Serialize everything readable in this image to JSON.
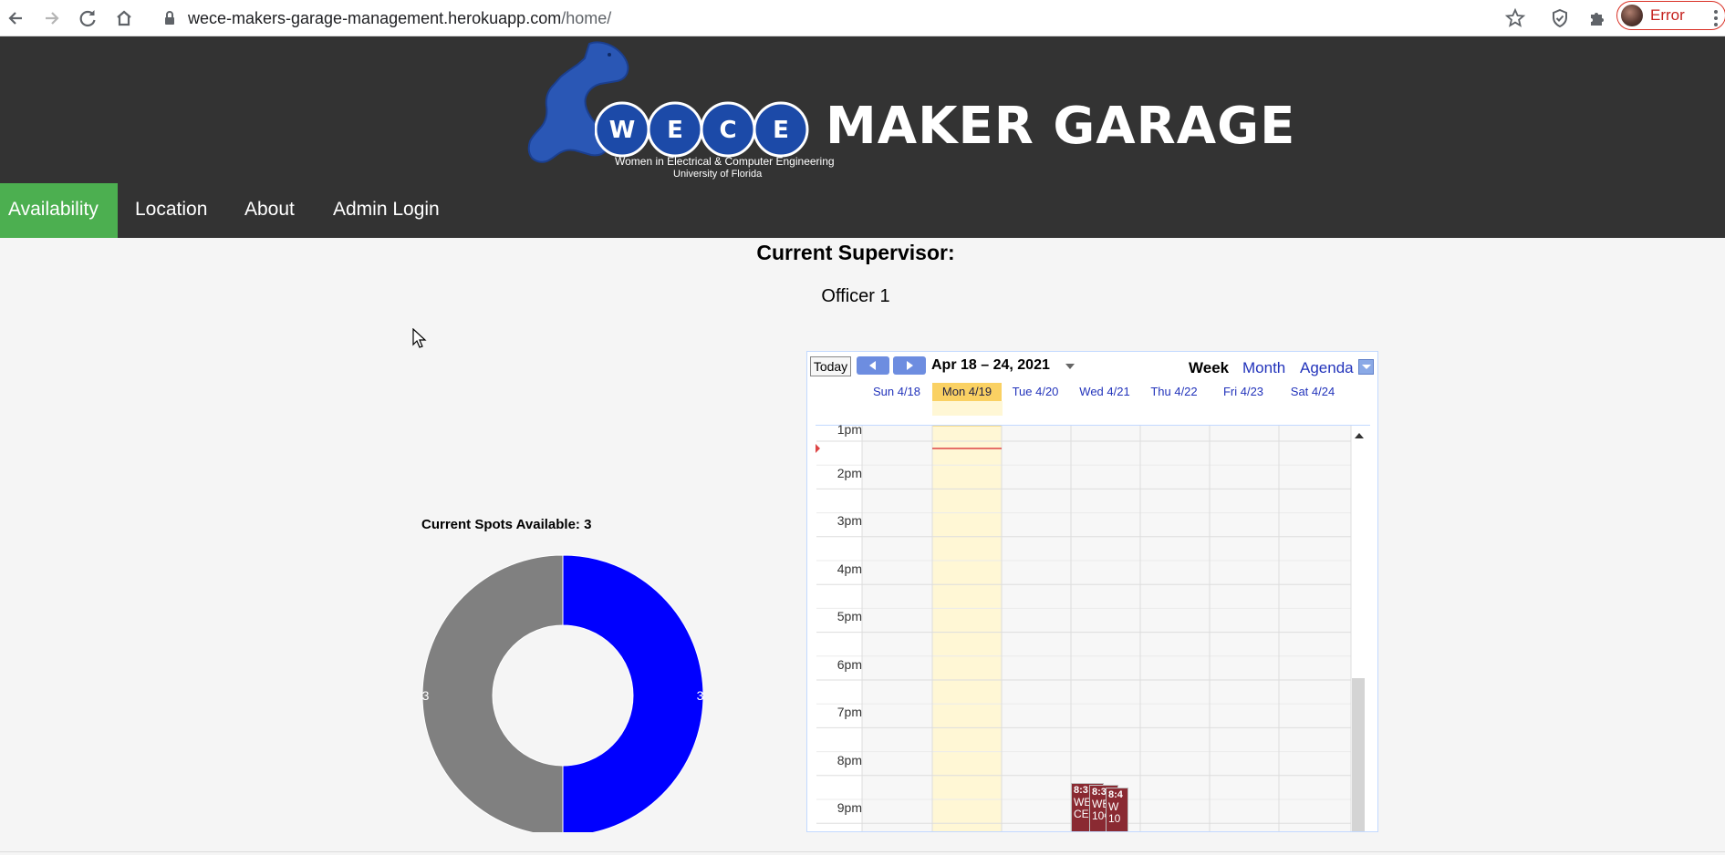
{
  "browser": {
    "url_domain": "wece-makers-garage-management.herokuapp.com",
    "url_path": "/home/",
    "profile_status": "Error"
  },
  "header": {
    "logo_letters": [
      "W",
      "E",
      "C",
      "E"
    ],
    "logo_title": "MAKER GARAGE",
    "logo_subtitle_1": "Women in Electrical & Computer Engineering",
    "logo_subtitle_2": "University of Florida"
  },
  "nav": {
    "items": [
      {
        "label": "Availability",
        "active": true
      },
      {
        "label": "Location",
        "active": false
      },
      {
        "label": "About",
        "active": false
      },
      {
        "label": "Admin Login",
        "active": false
      }
    ]
  },
  "supervisor": {
    "heading": "Current Supervisor:",
    "name": "Officer 1"
  },
  "chart_data": {
    "type": "pie",
    "title": "Current Spots Available: 3",
    "donut": true,
    "slices": [
      {
        "value": 3,
        "label": "3",
        "color": "#0000ff"
      },
      {
        "value": 3,
        "label": "3",
        "color": "#808080"
      }
    ]
  },
  "calendar": {
    "today_label": "Today",
    "date_range": "Apr 18 – 24, 2021",
    "views": {
      "week": "Week",
      "month": "Month",
      "agenda": "Agenda"
    },
    "selected_view": "Week",
    "days": [
      {
        "label": "Sun 4/18",
        "today": false
      },
      {
        "label": "Mon 4/19",
        "today": true
      },
      {
        "label": "Tue 4/20",
        "today": false
      },
      {
        "label": "Wed 4/21",
        "today": false
      },
      {
        "label": "Thu 4/22",
        "today": false
      },
      {
        "label": "Fri 4/23",
        "today": false
      },
      {
        "label": "Sat 4/24",
        "today": false
      }
    ],
    "time_labels": [
      "1pm",
      "2pm",
      "3pm",
      "4pm",
      "5pm",
      "6pm",
      "7pm",
      "8pm",
      "9pm"
    ],
    "events": [
      {
        "time": "8:3",
        "title": "WE CE"
      },
      {
        "time": "8:3",
        "title": "WE 10€"
      },
      {
        "time": "8:4",
        "title": "W 10"
      }
    ],
    "colors": {
      "today": "#fad163",
      "today_column": "#fff7d5",
      "event": "#8a2a32",
      "now_line": "#dd4444"
    }
  },
  "colors": {
    "header_bg": "#333333",
    "nav_active": "#4caf50",
    "page_bg": "#f5f5f5"
  }
}
